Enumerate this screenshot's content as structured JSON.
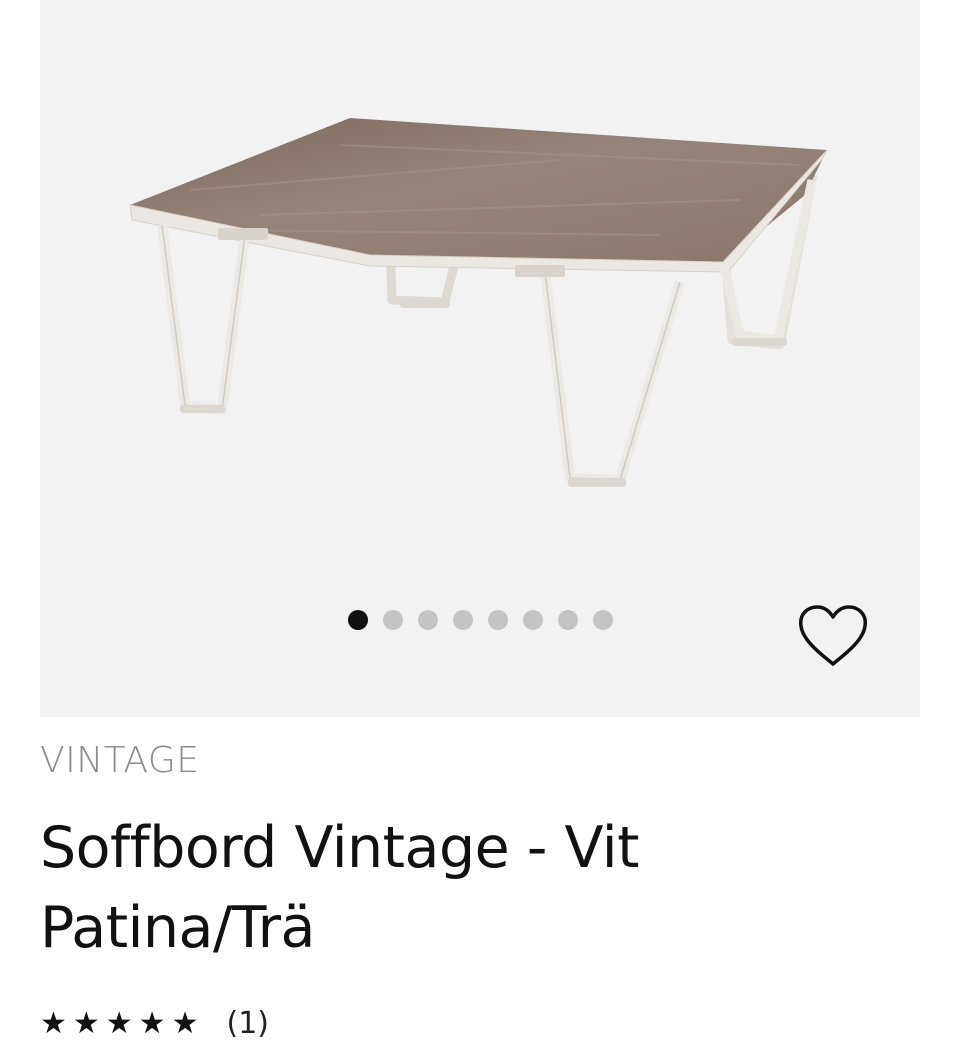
{
  "product": {
    "brand": "VINTAGE",
    "title": "Soffbord Vintage - Vit Patina/Trä",
    "rating": {
      "stars": "★★★★★",
      "value": 5,
      "max": 5,
      "count_label": "(1)"
    }
  },
  "gallery": {
    "image_count": 8,
    "active_index": 0,
    "background": "#f2f2f2"
  },
  "icons": {
    "wishlist": "heart-outline-icon"
  },
  "colors": {
    "active_dot": "#111111",
    "inactive_dot": "#c4c4c4",
    "brand_text": "#8a8a8a",
    "wood": "#8c7a6b",
    "frame": "#ece9e4"
  }
}
